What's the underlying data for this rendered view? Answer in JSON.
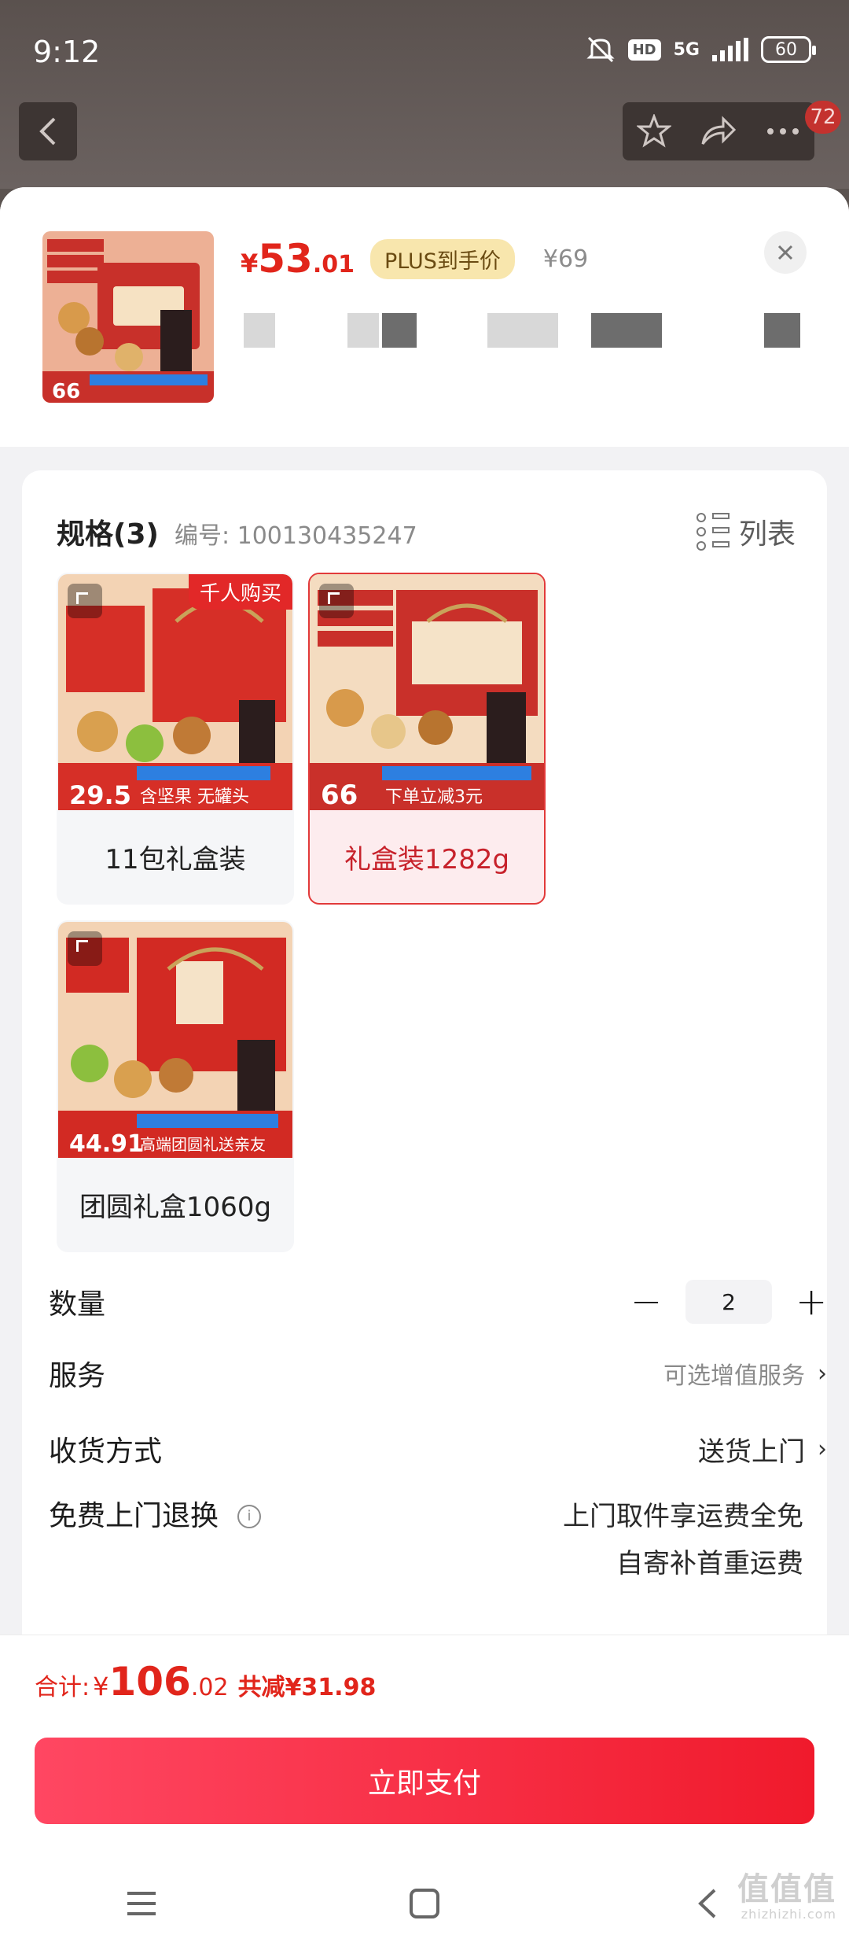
{
  "status_bar": {
    "time": "9:12",
    "network": "5G",
    "hd": "HD",
    "battery": "60"
  },
  "top_nav": {
    "message_count": "72"
  },
  "product": {
    "price_currency": "¥",
    "price_int": "53",
    "price_dec": ".01",
    "plus_label": "PLUS到手价",
    "original_price": "¥69"
  },
  "specs": {
    "title": "规格(3)",
    "code_label": "编号: 100130435247",
    "list_toggle": "列表",
    "variants": [
      {
        "label": "11包礼盒装",
        "tag": "千人购买",
        "selected": false,
        "image_price": "29.5",
        "image_text": "含坚果 无罐头"
      },
      {
        "label": "礼盒装1282g",
        "tag": "",
        "selected": true,
        "image_price": "66",
        "image_text": "下单立减3元"
      },
      {
        "label": "团圆礼盒1060g",
        "tag": "",
        "selected": false,
        "image_price": "44.91",
        "image_text": "高端团圆礼送亲友"
      }
    ]
  },
  "rows": {
    "quantity_label": "数量",
    "quantity_value": "2",
    "service_label": "服务",
    "service_value": "可选增值服务",
    "delivery_label": "收货方式",
    "delivery_value": "送货上门",
    "return_label": "免费上门退换",
    "return_line1": "上门取件享运费全免",
    "return_line2": "自寄补首重运费"
  },
  "footer": {
    "total_label": "合计:",
    "total_currency": "¥",
    "total_int": "106",
    "total_dec": ".02",
    "save_text": "共减¥31.98",
    "pay_button": "立即支付"
  },
  "watermark": {
    "main": "值值值",
    "sub": "zhizhizhi.com"
  },
  "colors": {
    "accent": "#e1251b",
    "pay_gradient_start": "#ff4762",
    "pay_gradient_end": "#f01a2c",
    "plus_badge": "#f8e6ad"
  }
}
